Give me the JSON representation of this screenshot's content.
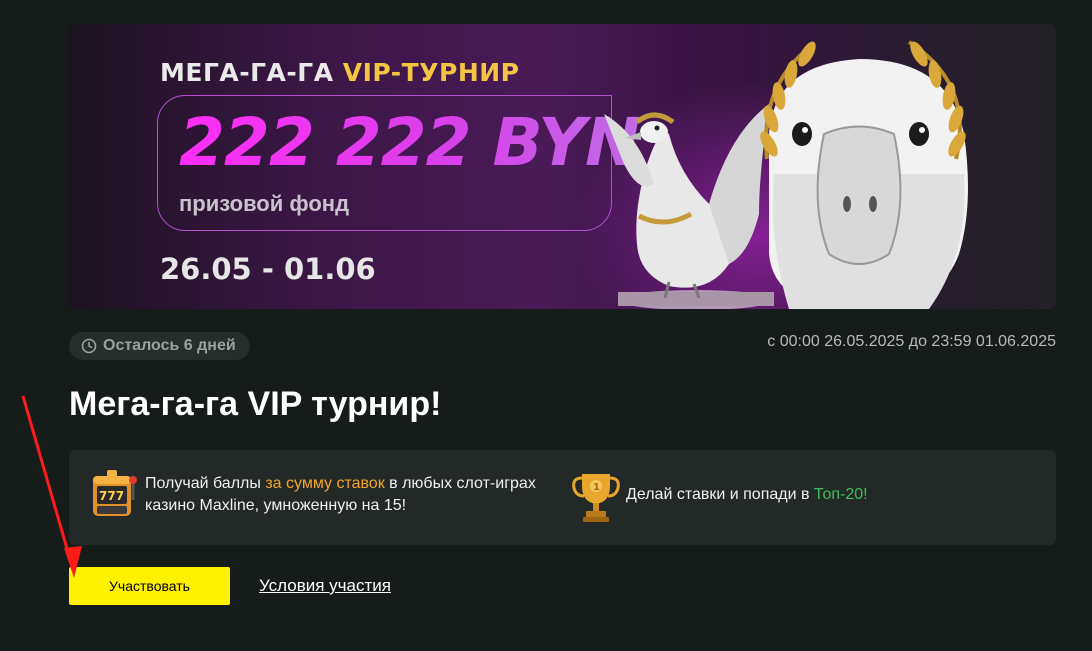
{
  "banner": {
    "subtitle_part1": "МЕГА-ГА-ГА",
    "subtitle_part2": "VIP-ТУРНИР",
    "prize_amount": "222 222 BYN",
    "prize_label": "призовой фонд",
    "dates": "26.05 - 01.06"
  },
  "timer": {
    "icon": "clock-icon",
    "text": "Осталось 6 дней"
  },
  "period": "с 00:00 26.05.2025 до 23:59 01.06.2025",
  "title": "Мега-га-га VIP турнир!",
  "rules": {
    "rule1": {
      "icon": "slot-machine-icon",
      "text_before": "Получай баллы ",
      "highlight": "за сумму ставок",
      "text_after": " в любых слот-играх казино Maxline, умноженную на 15!"
    },
    "rule2": {
      "icon": "trophy-icon",
      "text_before": "Делай ставки и попади в ",
      "highlight": "Топ-20!"
    }
  },
  "actions": {
    "join_label": "Участвовать",
    "terms_label": "Условия участия"
  },
  "colors": {
    "background": "#151c1a",
    "accent_yellow": "#fff200",
    "highlight_orange": "#f5a623",
    "highlight_green": "#3fbf5a",
    "prize_magenta": "#e92bf0"
  }
}
